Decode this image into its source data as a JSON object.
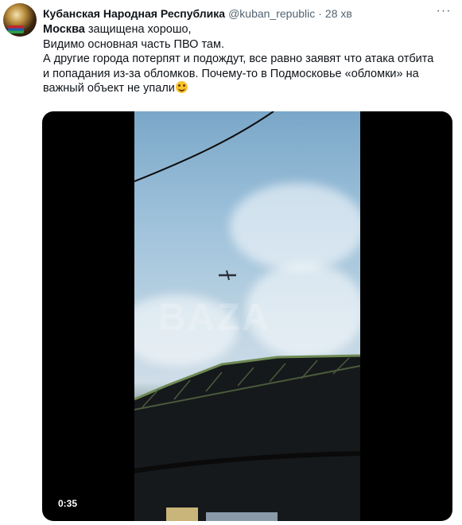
{
  "tweet": {
    "author_name": "Кубанская Народная Республика",
    "handle": "@kuban_republic",
    "separator": "·",
    "time": "28 хв",
    "more_icon": "more-dots-icon",
    "text_bold": "Москва",
    "text_line1_rest": " защищена хорошо,",
    "text_line2": "Видимо основная часть ПВО там.",
    "text_line3": "А другие города потерпят и подождут, все равно заявят что атака отбита",
    "text_line4": "и попадания из-за обломков. Почему-то в Подмосковье «обломки» на",
    "text_line5": "важный объект не упали",
    "emoji": "smiling-face-emoji"
  },
  "video": {
    "duration": "0:35",
    "watermark": "BAZA"
  }
}
